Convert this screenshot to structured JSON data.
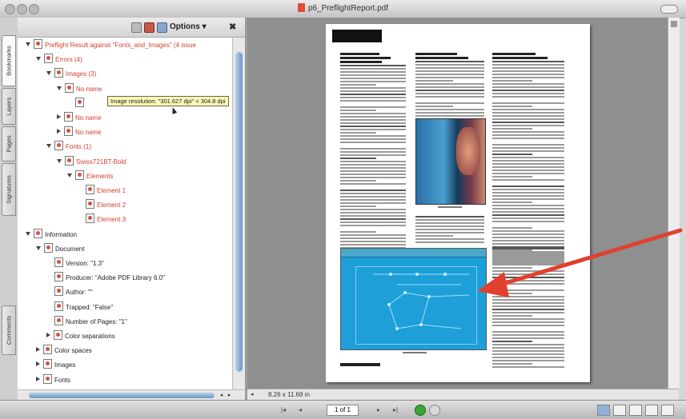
{
  "window": {
    "title": "p6_PreflightReport.pdf"
  },
  "side_tabs": [
    "Bookmarks",
    "Layers",
    "Pages",
    "Signatures",
    "Comments"
  ],
  "panel": {
    "options_label": "Options",
    "options_arrow": "▾",
    "close_label": "✖",
    "toolbar_icons": [
      "delete-icon",
      "bookmark-icon",
      "flag-icon"
    ]
  },
  "tree": [
    {
      "label": "Preflight Result against \"Fonts_and_Images\" (4 issue",
      "color": "red",
      "indent": 0,
      "expander": "down"
    },
    {
      "label": "Errors (4)",
      "color": "red",
      "indent": 1,
      "expander": "down"
    },
    {
      "label": "Images (3)",
      "color": "red",
      "indent": 2,
      "expander": "down"
    },
    {
      "label": "No name",
      "color": "red",
      "indent": 3,
      "expander": "down"
    },
    {
      "label": "",
      "color": "red",
      "indent": 4,
      "expander": "none"
    },
    {
      "label": "No name",
      "color": "red",
      "indent": 3,
      "expander": "right"
    },
    {
      "label": "No name",
      "color": "red",
      "indent": 3,
      "expander": "right"
    },
    {
      "label": "Fonts (1)",
      "color": "red",
      "indent": 2,
      "expander": "down"
    },
    {
      "label": "Swiss721BT-Bold",
      "color": "red",
      "indent": 3,
      "expander": "down"
    },
    {
      "label": "Elements",
      "color": "red",
      "indent": 4,
      "expander": "down"
    },
    {
      "label": "Element 1",
      "color": "red",
      "indent": 5,
      "expander": "none"
    },
    {
      "label": "Element 2",
      "color": "red",
      "indent": 5,
      "expander": "none"
    },
    {
      "label": "Element 3",
      "color": "red",
      "indent": 5,
      "expander": "none"
    },
    {
      "label": "Information",
      "color": "black",
      "indent": 0,
      "expander": "down"
    },
    {
      "label": "Document",
      "color": "black",
      "indent": 1,
      "expander": "down"
    },
    {
      "label": "Version: \"1.3\"",
      "color": "black",
      "indent": 2,
      "expander": "none"
    },
    {
      "label": "Producer: \"Adobe PDF Library 6.0\"",
      "color": "black",
      "indent": 2,
      "expander": "none"
    },
    {
      "label": "Author: \"\"",
      "color": "black",
      "indent": 2,
      "expander": "none"
    },
    {
      "label": "Trapped: \"False\"",
      "color": "black",
      "indent": 2,
      "expander": "none"
    },
    {
      "label": "Number of Pages: \"1\"",
      "color": "black",
      "indent": 2,
      "expander": "none"
    },
    {
      "label": "Color separations",
      "color": "black",
      "indent": 2,
      "expander": "right"
    },
    {
      "label": "Color spaces",
      "color": "black",
      "indent": 1,
      "expander": "right"
    },
    {
      "label": "Images",
      "color": "black",
      "indent": 1,
      "expander": "right"
    },
    {
      "label": "Fonts",
      "color": "black",
      "indent": 1,
      "expander": "right"
    }
  ],
  "tooltip": "Image resolution: \"301.627 dpi\" < 304.8 dpi",
  "status": {
    "page_size": "8.26 x 11.69 in",
    "toggle": "◂"
  },
  "navigation": {
    "first": "|◂",
    "prev": "◂",
    "page_field": "1 of 1",
    "next": "▸",
    "last": "▸|"
  },
  "colors": {
    "error_text": "#d43d2c",
    "arrow": "#e0412f",
    "screenshot_bg": "#1e9fd8"
  }
}
